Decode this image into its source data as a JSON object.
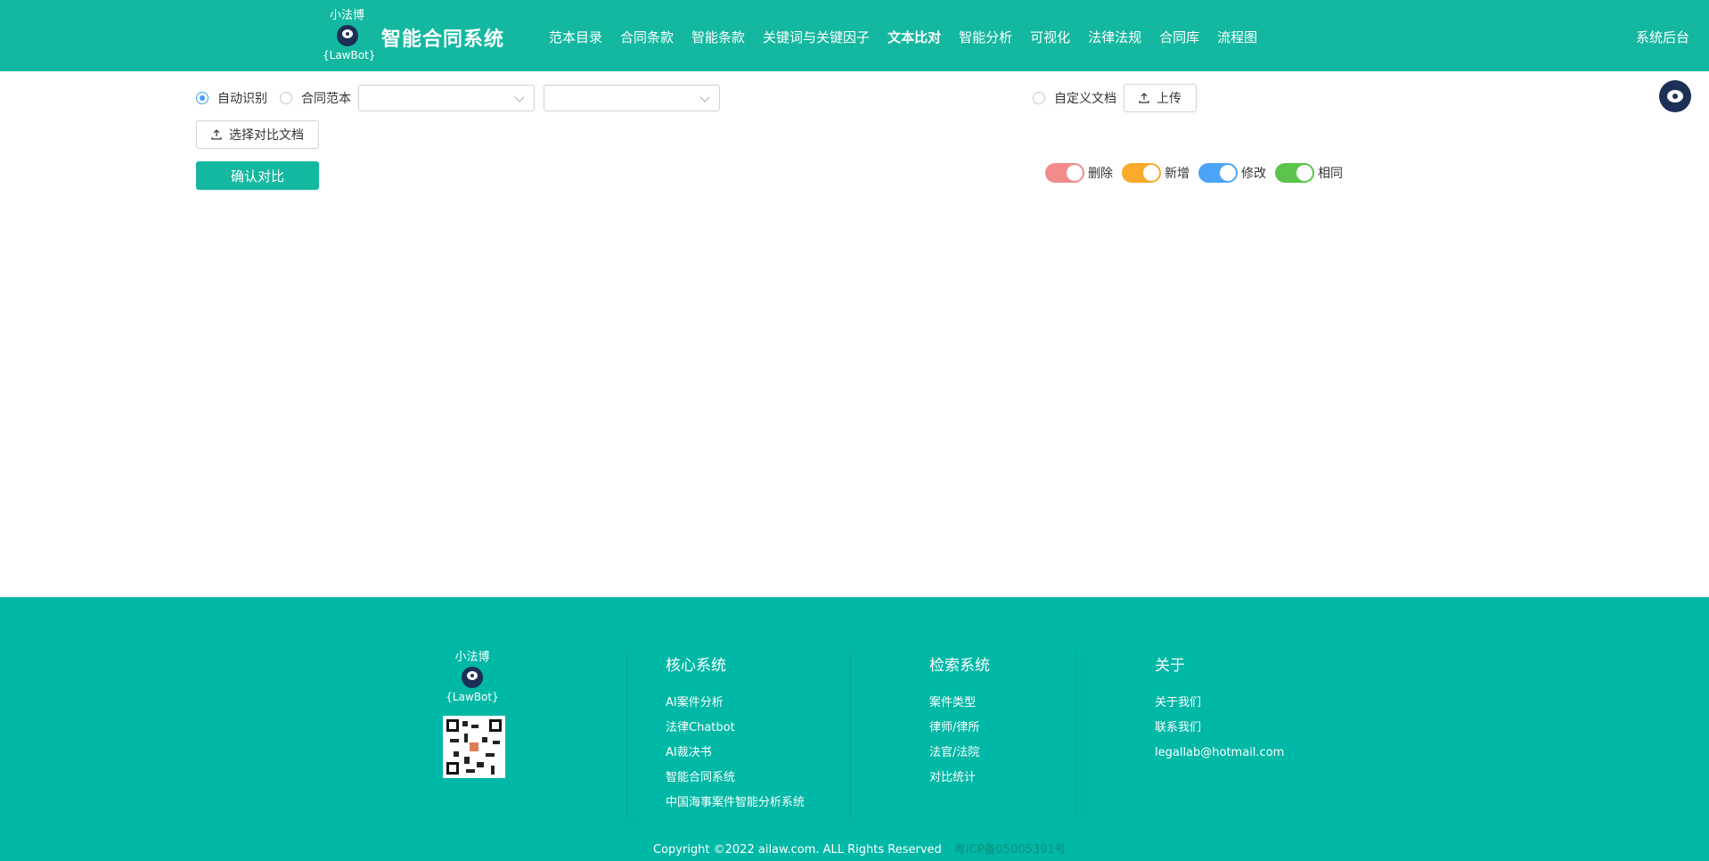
{
  "header": {
    "logo_top": "小法博",
    "logo_bottom": "{LawBot}",
    "title": "智能合同系统",
    "nav": [
      "范本目录",
      "合同条款",
      "智能条款",
      "关键词与关键因子",
      "文本比对",
      "智能分析",
      "可视化",
      "法律法规",
      "合同库",
      "流程图"
    ],
    "active_nav": "文本比对",
    "admin": "系统后台"
  },
  "toolbar": {
    "radio_auto": "自动识别",
    "radio_template": "合同范本",
    "select1_value": "",
    "select2_value": "",
    "radio_custom": "自定义文档",
    "upload_label": "上传",
    "select_doc_label": "选择对比文档",
    "confirm_label": "确认对比"
  },
  "legend": [
    {
      "label": "删除",
      "color": "#f28b8b"
    },
    {
      "label": "新增",
      "color": "#f8aa2a"
    },
    {
      "label": "修改",
      "color": "#4aa4f8"
    },
    {
      "label": "相同",
      "color": "#5cc44c"
    }
  ],
  "footer": {
    "logo_top": "小法博",
    "logo_bottom": "{LawBot}",
    "columns": [
      {
        "heading": "核心系统",
        "links": [
          "AI案件分析",
          "法律Chatbot",
          "AI裁决书",
          "智能合同系统",
          "中国海事案件智能分析系统"
        ]
      },
      {
        "heading": "检索系统",
        "links": [
          "案件类型",
          "律师/律所",
          "法官/法院",
          "对比统计"
        ]
      },
      {
        "heading": "关于",
        "links": [
          "关于我们",
          "联系我们",
          "legallab@hotmail.com"
        ]
      }
    ],
    "copyright": "Copyright ©2022 ailaw.com.   ALL Rights Reserved",
    "icp": "粤ICP备05005391号"
  },
  "colors": {
    "brand": "#14b8a0",
    "footer_bg": "#00b8a6",
    "radio_active": "#409eff"
  }
}
